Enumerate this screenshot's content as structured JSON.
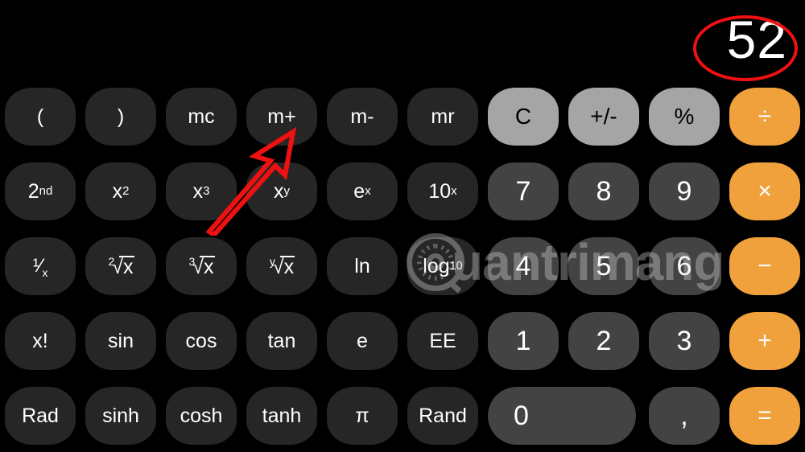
{
  "app": {
    "name": "Calculator",
    "mode": "scientific",
    "orientation": "landscape"
  },
  "display": {
    "value": "52"
  },
  "colors": {
    "background": "#000000",
    "function_key": "#262626",
    "digit_key": "#434343",
    "top_key": "#a5a5a5",
    "operator_key": "#f0a13c",
    "key_text": "#ffffff",
    "top_key_text": "#000000",
    "annotation": "#ee1111"
  },
  "annotations": {
    "ellipse": {
      "shape": "ellipse",
      "color": "#ee1111",
      "target": "display-value",
      "label": "52"
    },
    "arrow": {
      "shape": "arrow",
      "color": "#ee1111",
      "direction": "up-right",
      "target": "key-m-plus"
    }
  },
  "watermark": {
    "text": "uantrimang",
    "full_text": "Quantrimang",
    "logo": "circular-q-logo"
  },
  "keypad": {
    "rows": [
      {
        "keys": [
          {
            "name": "key-open-paren",
            "label": "(",
            "type": "function"
          },
          {
            "name": "key-close-paren",
            "label": ")",
            "type": "function"
          },
          {
            "name": "key-mc",
            "label": "mc",
            "type": "function"
          },
          {
            "name": "key-m-plus",
            "label": "m+",
            "type": "function"
          },
          {
            "name": "key-m-minus",
            "label": "m-",
            "type": "function"
          },
          {
            "name": "key-mr",
            "label": "mr",
            "type": "function"
          },
          {
            "name": "key-clear",
            "label": "C",
            "type": "top"
          },
          {
            "name": "key-sign",
            "label": "+/-",
            "type": "top"
          },
          {
            "name": "key-percent",
            "label": "%",
            "type": "top"
          },
          {
            "name": "key-divide",
            "label": "÷",
            "type": "operator"
          }
        ]
      },
      {
        "keys": [
          {
            "name": "key-second",
            "label": "2nd",
            "type": "function"
          },
          {
            "name": "key-x-squared",
            "label": "x2",
            "type": "function"
          },
          {
            "name": "key-x-cubed",
            "label": "x3",
            "type": "function"
          },
          {
            "name": "key-x-power-y",
            "label": "xy",
            "type": "function"
          },
          {
            "name": "key-e-power-x",
            "label": "ex",
            "type": "function"
          },
          {
            "name": "key-ten-power-x",
            "label": "10x",
            "type": "function"
          },
          {
            "name": "key-7",
            "label": "7",
            "type": "digit"
          },
          {
            "name": "key-8",
            "label": "8",
            "type": "digit"
          },
          {
            "name": "key-9",
            "label": "9",
            "type": "digit"
          },
          {
            "name": "key-multiply",
            "label": "×",
            "type": "operator"
          }
        ]
      },
      {
        "keys": [
          {
            "name": "key-reciprocal",
            "label": "1/x",
            "type": "function"
          },
          {
            "name": "key-square-root",
            "label": "2√x",
            "type": "function"
          },
          {
            "name": "key-cube-root",
            "label": "3√x",
            "type": "function"
          },
          {
            "name": "key-y-root",
            "label": "y√x",
            "type": "function"
          },
          {
            "name": "key-ln",
            "label": "ln",
            "type": "function"
          },
          {
            "name": "key-log10",
            "label": "log10",
            "type": "function"
          },
          {
            "name": "key-4",
            "label": "4",
            "type": "digit"
          },
          {
            "name": "key-5",
            "label": "5",
            "type": "digit"
          },
          {
            "name": "key-6",
            "label": "6",
            "type": "digit"
          },
          {
            "name": "key-subtract",
            "label": "−",
            "type": "operator"
          }
        ]
      },
      {
        "keys": [
          {
            "name": "key-factorial",
            "label": "x!",
            "type": "function"
          },
          {
            "name": "key-sin",
            "label": "sin",
            "type": "function"
          },
          {
            "name": "key-cos",
            "label": "cos",
            "type": "function"
          },
          {
            "name": "key-tan",
            "label": "tan",
            "type": "function"
          },
          {
            "name": "key-e",
            "label": "e",
            "type": "function"
          },
          {
            "name": "key-ee",
            "label": "EE",
            "type": "function"
          },
          {
            "name": "key-1",
            "label": "1",
            "type": "digit"
          },
          {
            "name": "key-2",
            "label": "2",
            "type": "digit"
          },
          {
            "name": "key-3",
            "label": "3",
            "type": "digit"
          },
          {
            "name": "key-add",
            "label": "+",
            "type": "operator"
          }
        ]
      },
      {
        "keys": [
          {
            "name": "key-rad",
            "label": "Rad",
            "type": "function"
          },
          {
            "name": "key-sinh",
            "label": "sinh",
            "type": "function"
          },
          {
            "name": "key-cosh",
            "label": "cosh",
            "type": "function"
          },
          {
            "name": "key-tanh",
            "label": "tanh",
            "type": "function"
          },
          {
            "name": "key-pi",
            "label": "π",
            "type": "function"
          },
          {
            "name": "key-rand",
            "label": "Rand",
            "type": "function"
          },
          {
            "name": "key-0",
            "label": "0",
            "type": "digit"
          },
          {
            "name": "key-decimal",
            "label": ",",
            "type": "digit"
          },
          {
            "name": "key-equals",
            "label": "=",
            "type": "operator"
          }
        ]
      }
    ]
  }
}
